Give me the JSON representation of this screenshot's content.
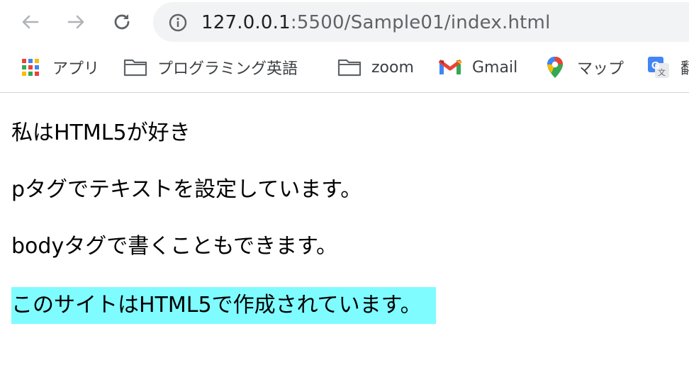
{
  "browser": {
    "url_host": "127.0.0.1",
    "url_rest": ":5500/Sample01/index.html"
  },
  "bookmarks": [
    {
      "label": "アプリ",
      "icon": "apps-grid-icon"
    },
    {
      "label": "プログラミング英語",
      "icon": "folder-icon"
    },
    {
      "label": "zoom",
      "icon": "folder-icon"
    },
    {
      "label": "Gmail",
      "icon": "gmail-icon"
    },
    {
      "label": "マップ",
      "icon": "maps-pin-icon"
    },
    {
      "label": "翻",
      "icon": "translate-icon"
    }
  ],
  "page": {
    "lines": [
      "私はHTML5が好き",
      "pタグでテキストを設定しています。",
      "bodyタグで書くこともできます。",
      "このサイトはHTML5で作成されています。"
    ],
    "highlight_color": "#7ffcff"
  },
  "colors": {
    "toolbar_bg": "#ffffff",
    "omnibox_bg": "#f1f3f4",
    "apps_dots": [
      "#ea4335",
      "#4285f4",
      "#fbbc05",
      "#34a853",
      "#ea4335",
      "#4285f4",
      "#fbbc05",
      "#34a853",
      "#ea4335"
    ]
  }
}
